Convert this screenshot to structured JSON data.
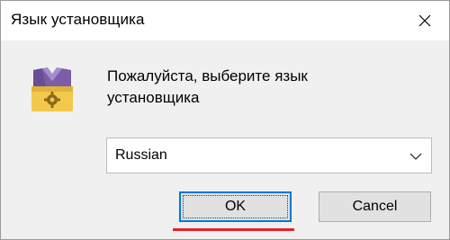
{
  "window": {
    "title": "Язык установщика"
  },
  "titlebar": {
    "close_icon": "close-icon"
  },
  "dialog": {
    "icon": "installer-package-icon",
    "message": "Пожалуйста, выберите язык установщика",
    "language_select": {
      "selected": "Russian",
      "icon": "chevron-down-icon"
    },
    "buttons": {
      "ok": "OK",
      "cancel": "Cancel"
    }
  },
  "colors": {
    "focus_border": "#0078d7",
    "annotation_underline": "#e8202a",
    "icon_purple": "#7b5ea7",
    "icon_yellow": "#f2c94c"
  }
}
